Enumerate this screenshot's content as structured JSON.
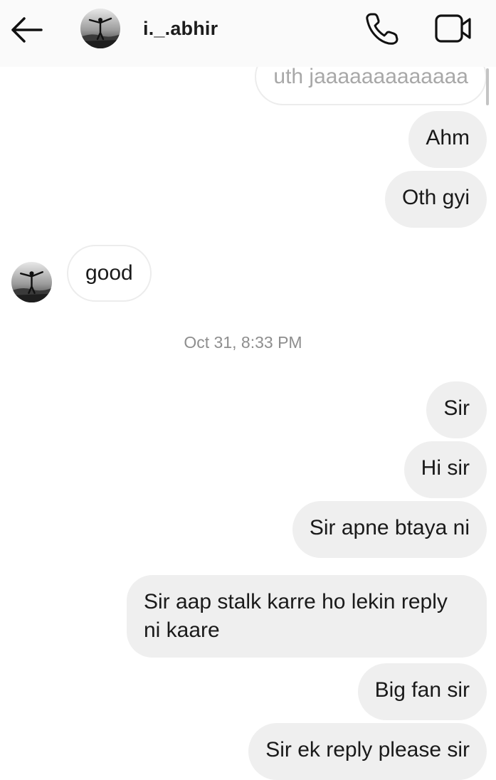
{
  "header": {
    "username": "i._.abhir",
    "back_icon": "arrow-left-icon",
    "call_icon": "phone-icon",
    "video_icon": "video-camera-icon"
  },
  "thread": {
    "messages": [
      {
        "from": "me",
        "text": "uth jaaaaaaaaaaaaa"
      },
      {
        "from": "me",
        "text": "Ahm"
      },
      {
        "from": "me",
        "text": "Oth gyi"
      },
      {
        "from": "them",
        "text": "good"
      },
      {
        "from": "me",
        "text": "Sir"
      },
      {
        "from": "me",
        "text": "Hi sir"
      },
      {
        "from": "me",
        "text": "Sir apne btaya ni"
      },
      {
        "from": "me",
        "text": "Sir aap stalk karre ho lekin reply ni kaare"
      },
      {
        "from": "me",
        "text": "Big fan sir"
      },
      {
        "from": "me",
        "text": "Sir ek reply please sir"
      }
    ],
    "timestamp": "Oct 31, 8:33 PM"
  }
}
